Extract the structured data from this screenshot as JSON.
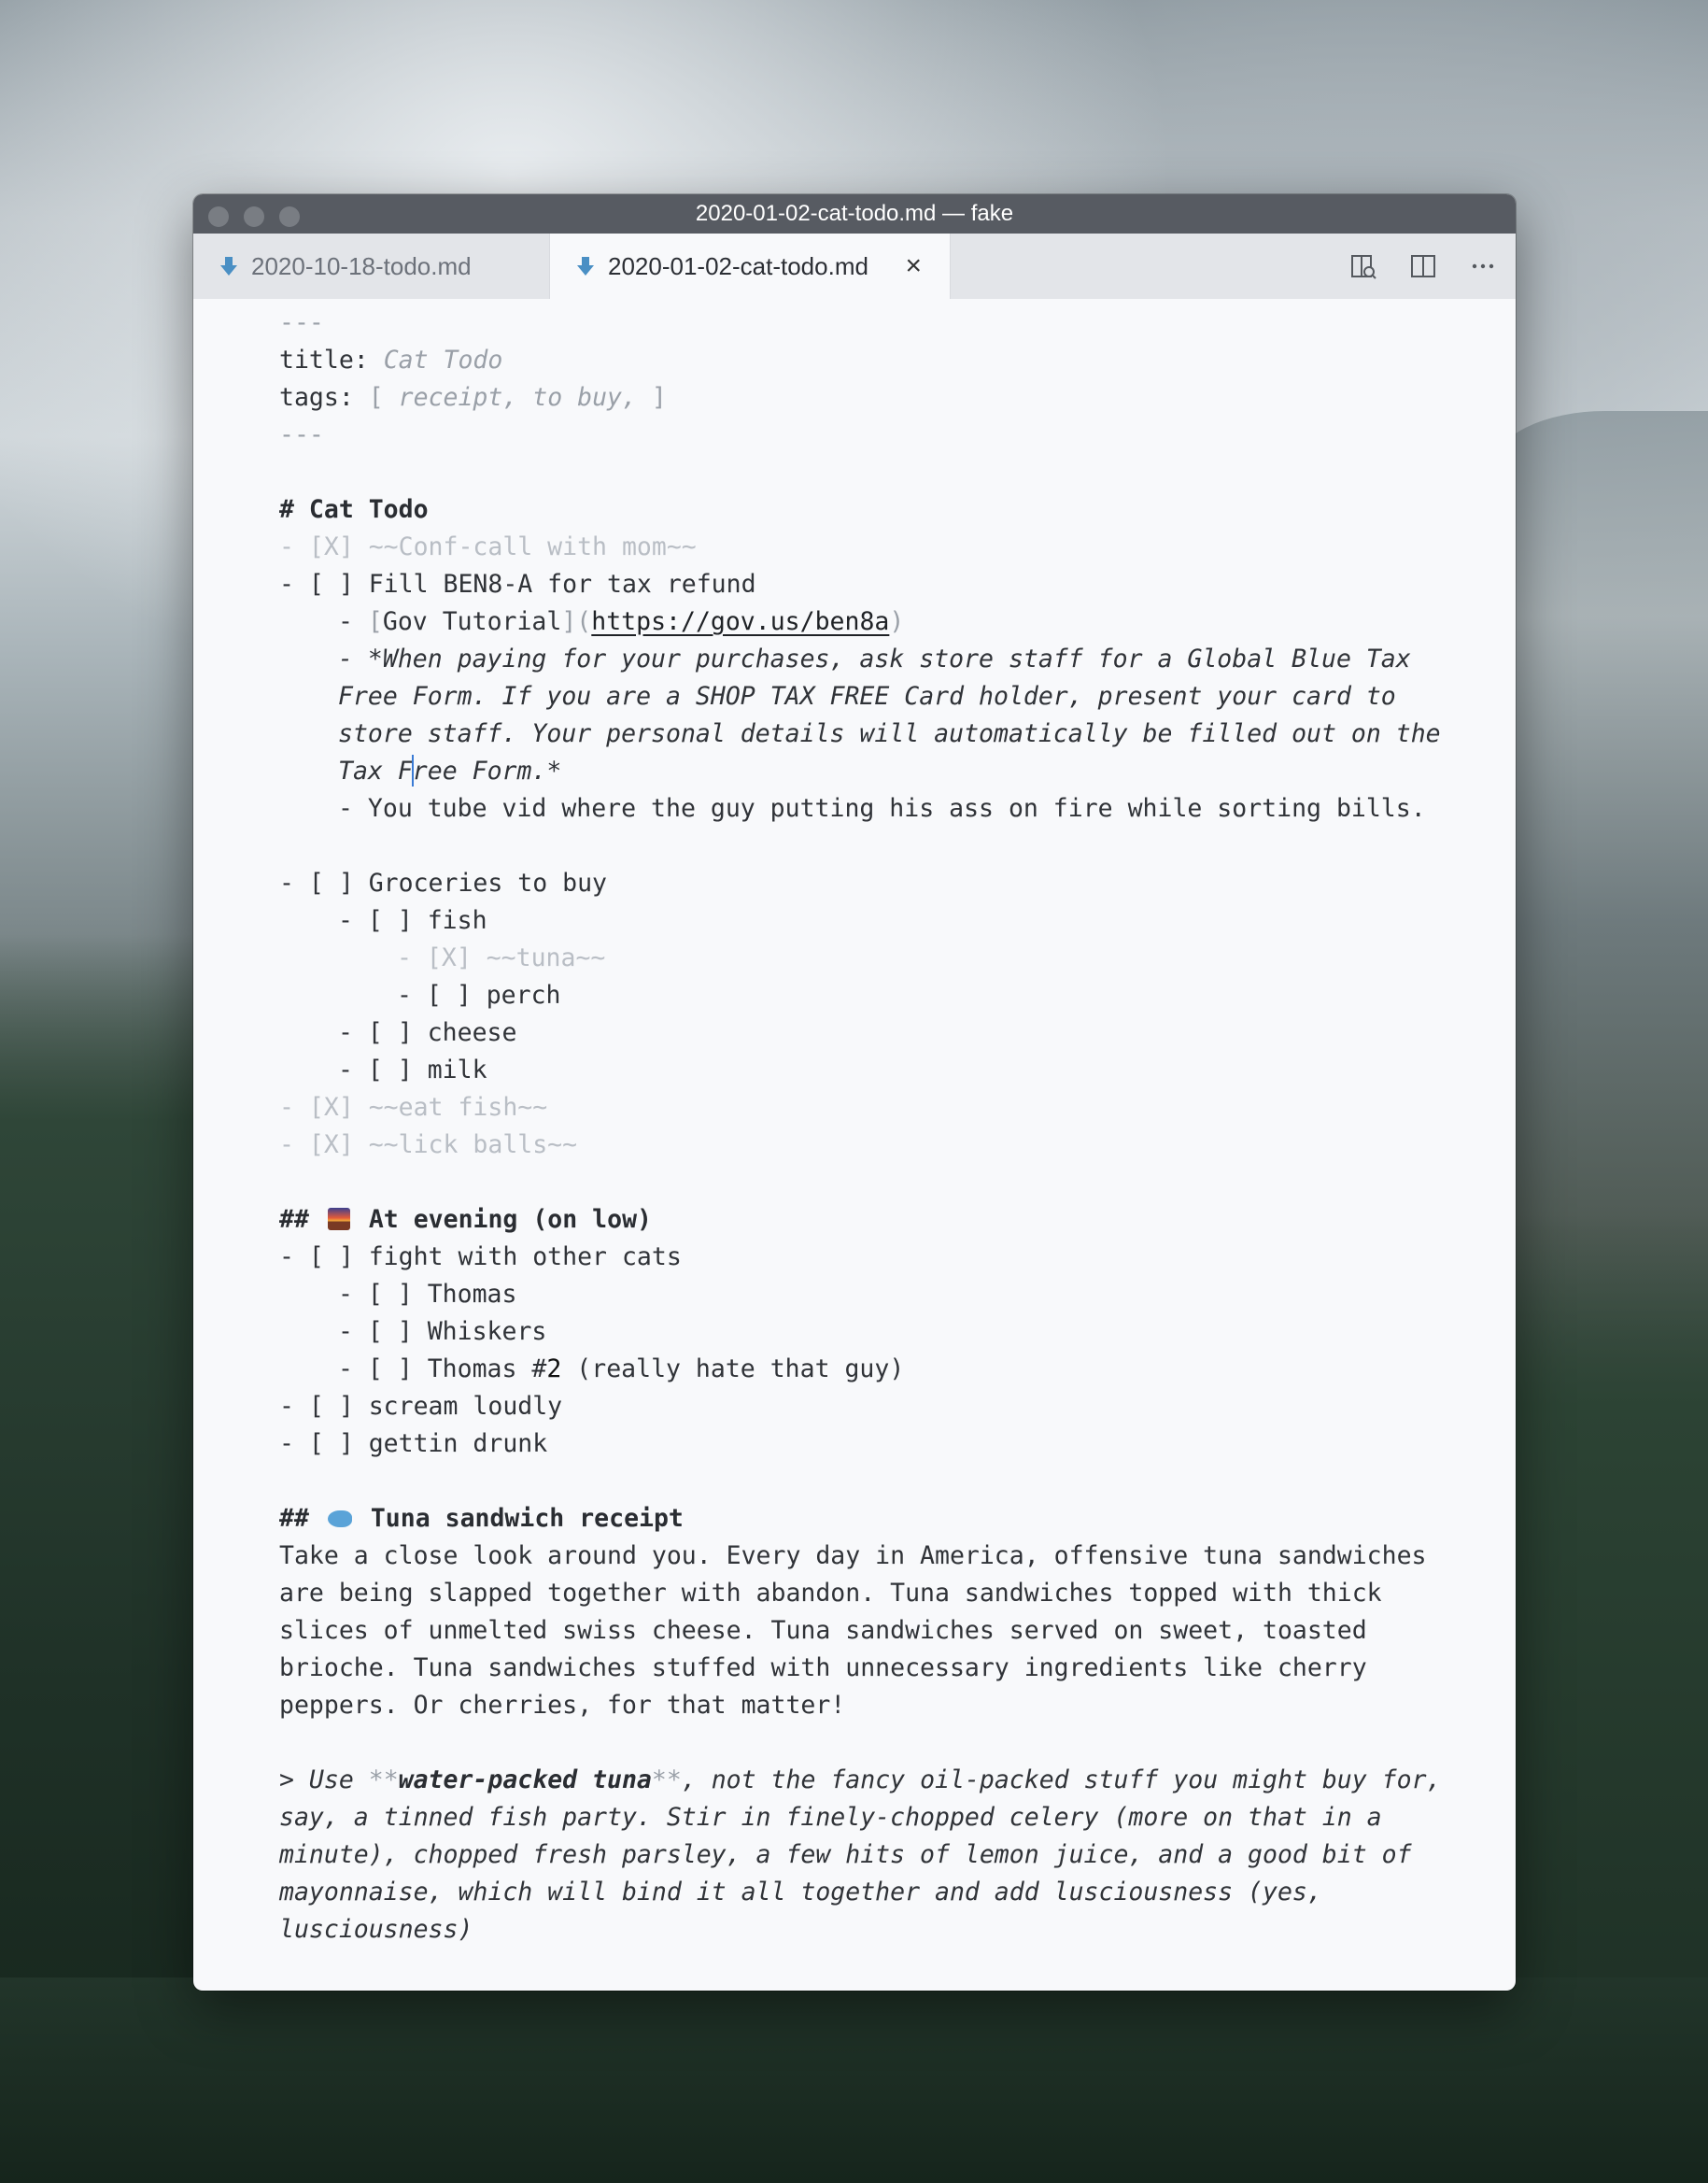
{
  "window": {
    "title": "2020-01-02-cat-todo.md — fake"
  },
  "tabs": [
    {
      "label": "2020-10-18-todo.md",
      "active": false
    },
    {
      "label": "2020-01-02-cat-todo.md",
      "active": true
    }
  ],
  "tab_actions": {
    "preview_icon": "open-preview-icon",
    "split_icon": "split-editor-icon",
    "more_icon": "more-actions-icon"
  },
  "editor": {
    "fm_sep": "---",
    "fm_title_key": "title: ",
    "fm_title_val": "Cat Todo",
    "fm_tags_key": "tags: ",
    "fm_tags_open": "[ ",
    "fm_tags_val": "receipt, to buy, ",
    "fm_tags_close": "]",
    "h1": "# Cat Todo",
    "l_confcall": "- [X] ~~Conf-call with mom~~",
    "l_fillben": "- [ ] Fill BEN8-A for tax refund",
    "link_prefix": "- ",
    "link_open": "[",
    "link_text": "Gov Tutorial",
    "link_mid": "](",
    "link_url": "https://gov.us/ben8a",
    "link_close": ")",
    "quote_1": "- *When paying for your purchases, ask store staff for a Global Blue Tax",
    "quote_2": "Free Form. If you are a SHOP TAX FREE Card holder, present your card to",
    "quote_3": "store staff. Your personal details will automatically be filled out on the",
    "quote_4a": "Tax F",
    "quote_4b": "r",
    "quote_4c": "ee Form.*",
    "youtube": "- You tube vid where the guy putting his ass on fire while sorting bills.",
    "groceries": "- [ ] Groceries to buy",
    "fish": "- [ ] fish",
    "tuna": "- [X] ~~tuna~~",
    "perch": "- [ ] perch",
    "cheese": "- [ ] cheese",
    "milk": "- [ ] milk",
    "eatfish": "- [X] ~~eat fish~~",
    "lickballs": "- [X] ~~lick balls~~",
    "h2_evening_prefix": "## ",
    "h2_evening": "At evening (on low)",
    "fight": "- [ ] fight with other cats",
    "thomas": "- [ ] Thomas",
    "whiskers": "- [ ] Whiskers",
    "thomas2a": "- [ ] Thomas #",
    "thomas2b": "2",
    "thomas2c": " (really hate that guy)",
    "scream": "- [ ] scream loudly",
    "drunk": "- [ ] gettin drunk",
    "h2_tuna_prefix": "## ",
    "h2_tuna": "Tuna sandwich receipt",
    "para_1": "Take a close look around you. Every day in America, offensive tuna sandwiches",
    "para_2": "are being slapped together with abandon. Tuna sandwiches topped with thick",
    "para_3": "slices of unmelted swiss cheese. Tuna sandwiches served on sweet, toasted",
    "para_4": "brioche. Tuna sandwiches stuffed with unnecessary ingredients like cherry",
    "para_5": "peppers. Or cherries, for that matter!",
    "bq_1a": "> Use ",
    "bq_1b": "**",
    "bq_1c": "water-packed tuna",
    "bq_1d": "**",
    "bq_1e": ", not the fancy oil-packed stuff you might buy for,",
    "bq_2": "say, a tinned fish party. Stir in finely-chopped celery (more on that in a",
    "bq_3": "minute), chopped fresh parsley, a few hits of lemon juice, and a good bit of",
    "bq_4": "mayonnaise, which will bind it all together and add lusciousness (yes,",
    "bq_5": "lusciousness)"
  }
}
